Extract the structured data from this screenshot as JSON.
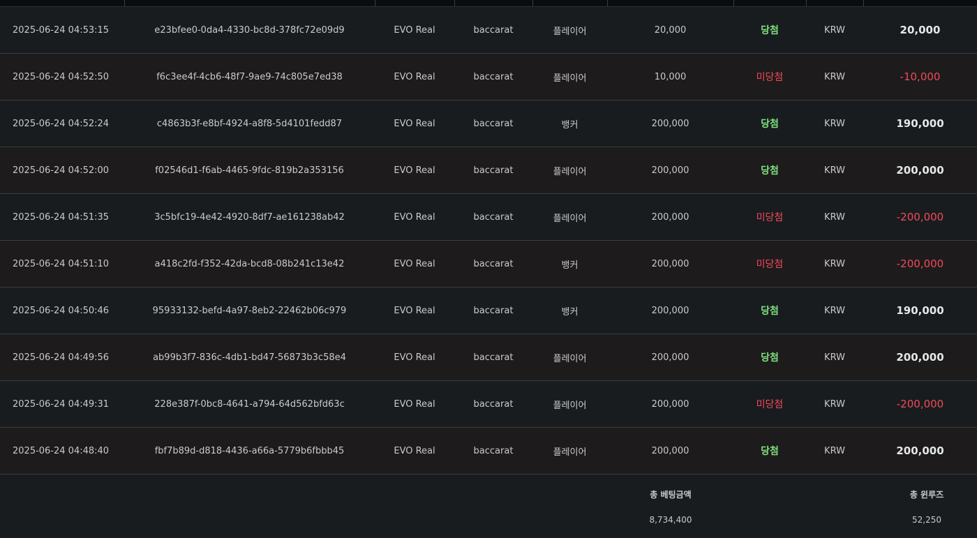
{
  "colors": {
    "background": "#191c1e",
    "row_alt": "#1d1b1b",
    "win_text": "#7ee07f",
    "lose_text": "#f24a5c",
    "divider": "#3b3e41"
  },
  "rows": [
    {
      "time": "2025-06-24 04:53:15",
      "id": "e23bfee0-0da4-4330-bc8d-378fc72e09d9",
      "vendor": "EVO Real",
      "game": "baccarat",
      "pick": "플레이어",
      "bet": "20,000",
      "status": "당첨",
      "currency": "KRW",
      "amount": "20,000",
      "result": "win"
    },
    {
      "time": "2025-06-24 04:52:50",
      "id": "f6c3ee4f-4cb6-48f7-9ae9-74c805e7ed38",
      "vendor": "EVO Real",
      "game": "baccarat",
      "pick": "플레이어",
      "bet": "10,000",
      "status": "미당첨",
      "currency": "KRW",
      "amount": "-10,000",
      "result": "lose"
    },
    {
      "time": "2025-06-24 04:52:24",
      "id": "c4863b3f-e8bf-4924-a8f8-5d4101fedd87",
      "vendor": "EVO Real",
      "game": "baccarat",
      "pick": "뱅커",
      "bet": "200,000",
      "status": "당첨",
      "currency": "KRW",
      "amount": "190,000",
      "result": "win"
    },
    {
      "time": "2025-06-24 04:52:00",
      "id": "f02546d1-f6ab-4465-9fdc-819b2a353156",
      "vendor": "EVO Real",
      "game": "baccarat",
      "pick": "플레이어",
      "bet": "200,000",
      "status": "당첨",
      "currency": "KRW",
      "amount": "200,000",
      "result": "win"
    },
    {
      "time": "2025-06-24 04:51:35",
      "id": "3c5bfc19-4e42-4920-8df7-ae161238ab42",
      "vendor": "EVO Real",
      "game": "baccarat",
      "pick": "플레이어",
      "bet": "200,000",
      "status": "미당첨",
      "currency": "KRW",
      "amount": "-200,000",
      "result": "lose"
    },
    {
      "time": "2025-06-24 04:51:10",
      "id": "a418c2fd-f352-42da-bcd8-08b241c13e42",
      "vendor": "EVO Real",
      "game": "baccarat",
      "pick": "뱅커",
      "bet": "200,000",
      "status": "미당첨",
      "currency": "KRW",
      "amount": "-200,000",
      "result": "lose"
    },
    {
      "time": "2025-06-24 04:50:46",
      "id": "95933132-befd-4a97-8eb2-22462b06c979",
      "vendor": "EVO Real",
      "game": "baccarat",
      "pick": "뱅커",
      "bet": "200,000",
      "status": "당첨",
      "currency": "KRW",
      "amount": "190,000",
      "result": "win"
    },
    {
      "time": "2025-06-24 04:49:56",
      "id": "ab99b3f7-836c-4db1-bd47-56873b3c58e4",
      "vendor": "EVO Real",
      "game": "baccarat",
      "pick": "플레이어",
      "bet": "200,000",
      "status": "당첨",
      "currency": "KRW",
      "amount": "200,000",
      "result": "win"
    },
    {
      "time": "2025-06-24 04:49:31",
      "id": "228e387f-0bc8-4641-a794-64d562bfd63c",
      "vendor": "EVO Real",
      "game": "baccarat",
      "pick": "플레이어",
      "bet": "200,000",
      "status": "미당첨",
      "currency": "KRW",
      "amount": "-200,000",
      "result": "lose"
    },
    {
      "time": "2025-06-24 04:48:40",
      "id": "fbf7b89d-d818-4436-a66a-5779b6fbbb45",
      "vendor": "EVO Real",
      "game": "baccarat",
      "pick": "플레이어",
      "bet": "200,000",
      "status": "당첨",
      "currency": "KRW",
      "amount": "200,000",
      "result": "win"
    }
  ],
  "summary": {
    "total_bet_label": "총 베팅금액",
    "total_bet_value": "8,734,400",
    "total_winloss_label": "총 윈루즈",
    "total_winloss_value": "52,250"
  }
}
